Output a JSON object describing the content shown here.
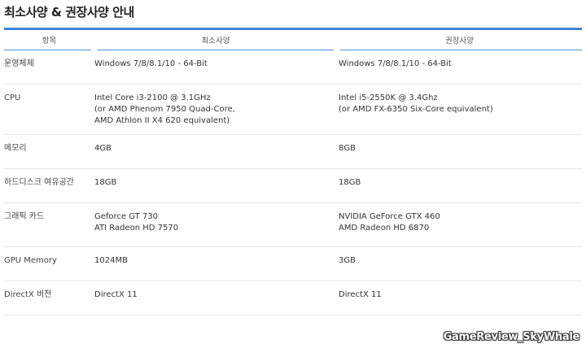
{
  "title": "최소사양 & 권장사양 안내",
  "headers": {
    "item": "항목",
    "minimum": "최소사양",
    "recommended": "권장사양"
  },
  "rows": [
    {
      "label": "운영체제",
      "min": [
        "Windows 7/8/8.1/10 - 64-Bit"
      ],
      "rec": [
        "Windows 7/8/8.1/10 - 64-Bit"
      ]
    },
    {
      "label": "CPU",
      "min": [
        "Intel Core i3-2100 @ 3.1GHz",
        "(or AMD Phenom 7950 Quad-Core,",
        "AMD Athlon II X4 620 equivalent)"
      ],
      "rec": [
        "Intel i5-2550K @ 3.4Ghz",
        "(or AMD FX-6350 Six-Core equivalent)"
      ]
    },
    {
      "label": "메모리",
      "min": [
        "4GB"
      ],
      "rec": [
        "8GB"
      ]
    },
    {
      "label": "하드디스크 여유공간",
      "min": [
        "18GB"
      ],
      "rec": [
        "18GB"
      ]
    },
    {
      "label": "그래픽 카드",
      "min": [
        "Geforce GT 730",
        "ATI Radeon HD 7570"
      ],
      "rec": [
        "NVIDIA GeForce GTX 460",
        "AMD Radeon HD 6870"
      ]
    },
    {
      "label": "GPU Memory",
      "min": [
        "1024MB"
      ],
      "rec": [
        "3GB"
      ]
    },
    {
      "label": "DirectX 버전",
      "min": [
        "DirectX 11"
      ],
      "rec": [
        "DirectX 11"
      ]
    }
  ],
  "watermark": "GameReview_SkyWhale",
  "colors": {
    "accent": "#3b86d6"
  }
}
